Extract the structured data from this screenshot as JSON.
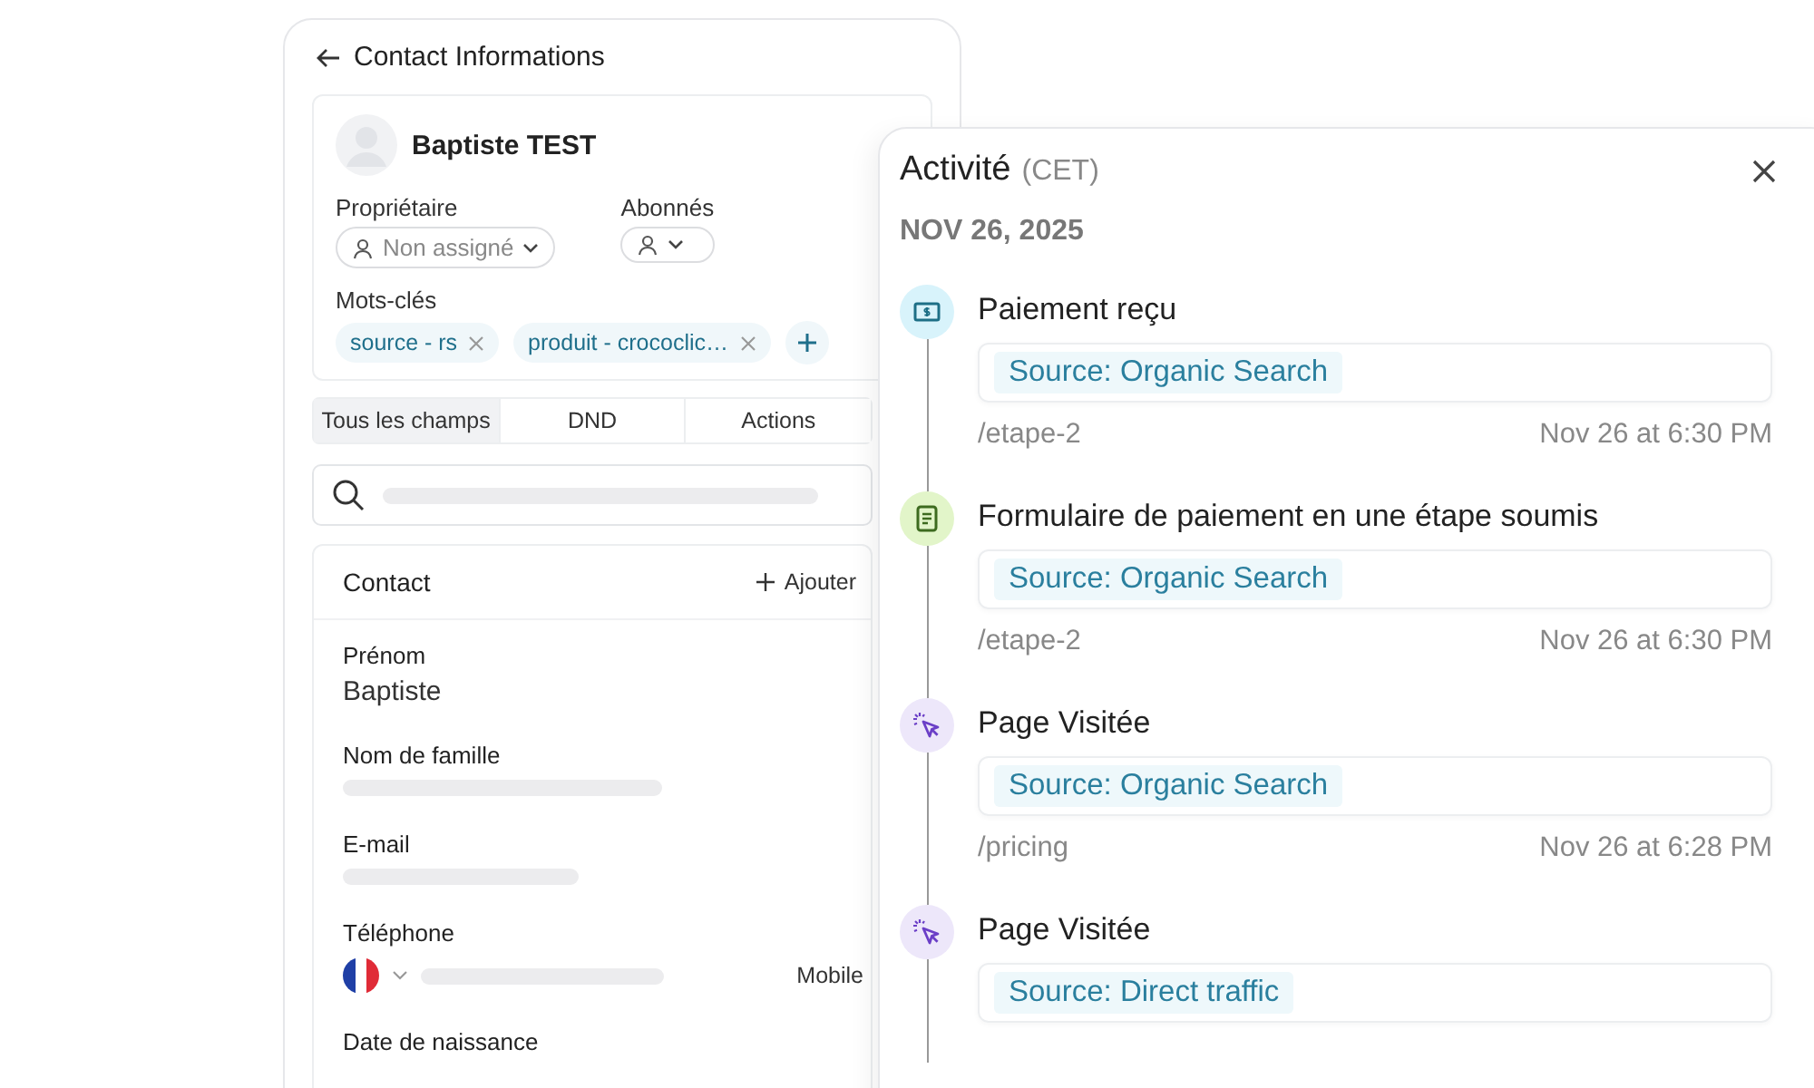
{
  "contact_panel": {
    "title": "Contact Informations",
    "contact_name": "Baptiste TEST",
    "owner": {
      "label": "Propriétaire",
      "value": "Non assigné"
    },
    "followers": {
      "label": "Abonnés"
    },
    "tags_label": "Mots-clés",
    "tags": [
      "source - rs",
      "produit - crococlic…"
    ],
    "tabs": [
      {
        "label": "Tous les champs",
        "selected": true
      },
      {
        "label": "DND",
        "selected": false
      },
      {
        "label": "Actions",
        "selected": false
      }
    ],
    "search": {
      "hidden": true
    },
    "section": {
      "title": "Contact",
      "add_label": "Ajouter",
      "fields": [
        {
          "kind": "text",
          "label": "Prénom",
          "value": "Baptiste"
        },
        {
          "kind": "text",
          "label": "Nom de famille",
          "hidden": true
        },
        {
          "kind": "text",
          "label": "E-mail",
          "hidden": true
        },
        {
          "kind": "phone",
          "label": "Téléphone",
          "hidden": true,
          "phone_type": "Mobile"
        },
        {
          "kind": "text",
          "label": "Date de naissance"
        }
      ]
    }
  },
  "activity_panel": {
    "title": "Activité",
    "timezone": "(CET)",
    "date": "NOV 26, 2025",
    "events": [
      {
        "kind": "payment",
        "title": "Paiement reçu",
        "source": "Source: Organic Search",
        "path": "/etape-2",
        "time": "Nov 26 at 6:30 PM"
      },
      {
        "kind": "form",
        "title": "Formulaire de paiement en une étape soumis",
        "source": "Source: Organic Search",
        "path": "/etape-2",
        "time": "Nov 26 at 6:30 PM"
      },
      {
        "kind": "visit",
        "title": "Page Visitée",
        "source": "Source: Organic Search",
        "path": "/pricing",
        "time": "Nov 26 at 6:28 PM"
      },
      {
        "kind": "visit",
        "title": "Page Visitée",
        "source": "Source: Direct traffic"
      }
    ]
  }
}
